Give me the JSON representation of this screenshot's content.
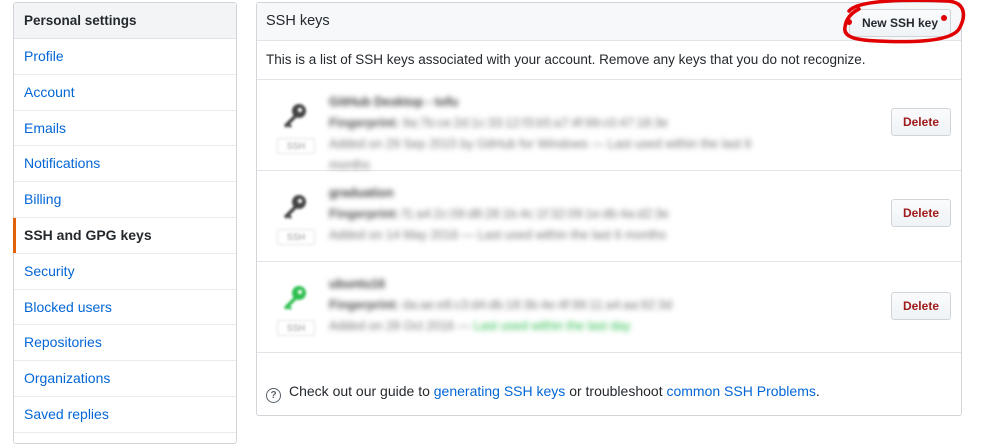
{
  "sidebar": {
    "header": "Personal settings",
    "items": [
      {
        "label": "Profile"
      },
      {
        "label": "Account"
      },
      {
        "label": "Emails"
      },
      {
        "label": "Notifications"
      },
      {
        "label": "Billing"
      },
      {
        "label": "SSH and GPG keys",
        "selected": true
      },
      {
        "label": "Security"
      },
      {
        "label": "Blocked users"
      },
      {
        "label": "Repositories"
      },
      {
        "label": "Organizations"
      },
      {
        "label": "Saved replies"
      }
    ]
  },
  "panel": {
    "title": "SSH keys",
    "new_button": "New SSH key",
    "intro": "This is a list of SSH keys associated with your account. Remove any keys that you do not recognize.",
    "keys": [
      {
        "title": "GitHub Desktop - tofu",
        "fingerprint_label": "Fingerprint:",
        "fingerprint": "9a:7b:ce:2d:1c:33:12:f3:b5:a7:4f:99:c0:47:18:3e",
        "added": "Added on 29 Sep 2015 by GitHub for Windows — Last used within the last 6 months",
        "type_badge": "SSH",
        "icon_color": "#444",
        "delete_label": "Delete"
      },
      {
        "title": "graduation",
        "fingerprint_label": "Fingerprint:",
        "fingerprint": "f1:a4:2c:09:d8:28:1b:4c:1f:32:09:1e:db:4a:d2:3e",
        "added": "Added on 14 May 2016 — Last used within the last 6 months",
        "type_badge": "SSH",
        "icon_color": "#444",
        "delete_label": "Delete"
      },
      {
        "title": "ubuntu16",
        "fingerprint_label": "Fingerprint:",
        "fingerprint": "da:ae:e8:c3:d4:db:18:3b:4e:4f:99:11:a4:aa:92:3d",
        "added": "Added on 28 Oct 2016",
        "recent": "Last used within the last day",
        "type_badge": "SSH",
        "icon_color": "#2cbe4e",
        "delete_label": "Delete"
      }
    ],
    "footer": {
      "prefix": "Check out our guide to",
      "link1": "generating SSH keys",
      "middle": "or troubleshoot",
      "link2": "common SSH Problems",
      "suffix": "."
    }
  },
  "colors": {
    "link": "#0366d6",
    "selected_marker": "#e36209",
    "delete_text": "#a01b1b",
    "annotation": "#e00000"
  },
  "annotation_marker": "red-scribble-around-new-ssh-key"
}
